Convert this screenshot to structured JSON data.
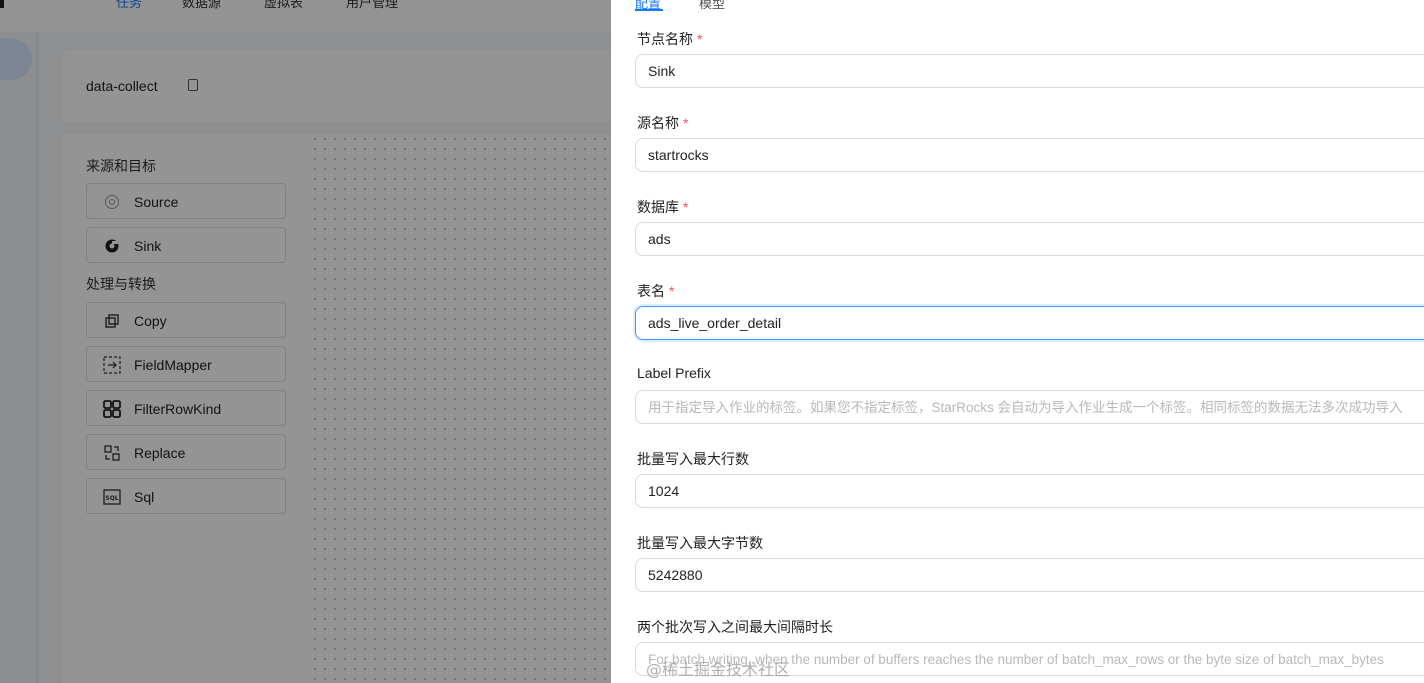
{
  "top_nav": {
    "tabs": [
      "任务",
      "数据源",
      "虚拟表",
      "用户管理"
    ]
  },
  "job": {
    "name": "data-collect"
  },
  "palette": {
    "section1_title": "来源和目标",
    "section1_items": [
      {
        "label": "Source",
        "icon": "target-icon"
      },
      {
        "label": "Sink",
        "icon": "sink-icon"
      }
    ],
    "section2_title": "处理与转换",
    "section2_items": [
      {
        "label": "Copy",
        "icon": "copy-icon"
      },
      {
        "label": "FieldMapper",
        "icon": "field-mapper-icon"
      },
      {
        "label": "FilterRowKind",
        "icon": "grid-icon"
      },
      {
        "label": "Replace",
        "icon": "replace-icon"
      },
      {
        "label": "Sql",
        "icon": "sql-icon"
      }
    ]
  },
  "drawer": {
    "tabs": [
      "配置",
      "模型"
    ],
    "active_tab": "配置",
    "fields": [
      {
        "label": "节点名称",
        "required": "*",
        "value": "Sink",
        "placeholder": ""
      },
      {
        "label": "源名称",
        "required": "*",
        "value": "startrocks",
        "placeholder": ""
      },
      {
        "label": "数据库",
        "required": "*",
        "value": "ads",
        "placeholder": ""
      },
      {
        "label": "表名",
        "required": "*",
        "value": "ads_live_order_detail",
        "placeholder": ""
      },
      {
        "label": "Label Prefix",
        "required": "",
        "value": "",
        "placeholder": "用于指定导入作业的标签。如果您不指定标签，StarRocks 会自动为导入作业生成一个标签。相同标签的数据无法多次成功导入"
      },
      {
        "label": "批量写入最大行数",
        "required": "",
        "value": "1024",
        "placeholder": ""
      },
      {
        "label": "批量写入最大字节数",
        "required": "",
        "value": "5242880",
        "placeholder": ""
      },
      {
        "label": "两个批次写入之间最大间隔时长",
        "required": "",
        "value": "",
        "placeholder": "For batch writing, when the number of buffers reaches the number of batch_max_rows or the byte size of batch_max_bytes"
      }
    ]
  },
  "watermark": "@稀土掘金技术社区",
  "colors": {
    "primary": "#1677ff",
    "required": "#ff4d4f"
  }
}
